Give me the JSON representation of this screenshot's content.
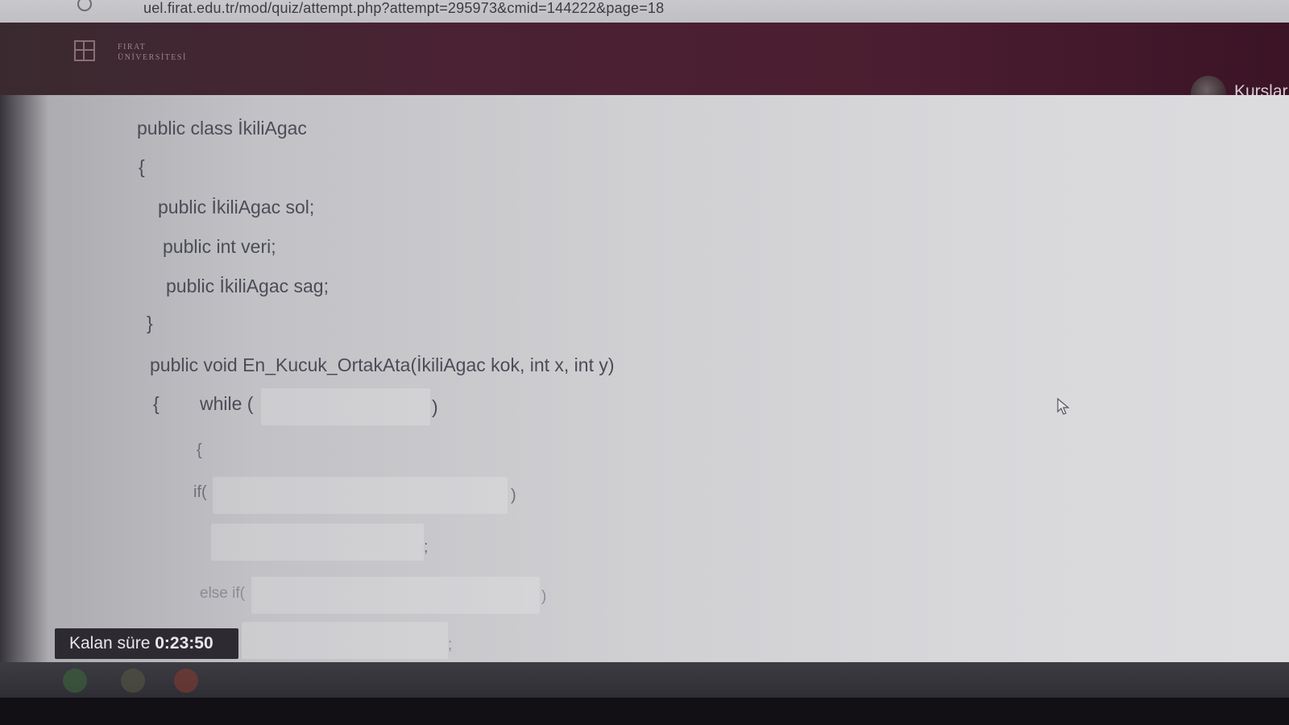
{
  "browser": {
    "url": "uel.firat.edu.tr/mod/quiz/attempt.php?attempt=295973&cmid=144222&page=18"
  },
  "header": {
    "logo_line1": "FIRAT",
    "logo_line2": "ÜNİVERSİTESİ",
    "nav_link": "Kurslar"
  },
  "question": {
    "code_lines": [
      "public class İkiliAgac",
      "{",
      "public İkiliAgac sol;",
      "public int veri;",
      "public İkiliAgac sag;",
      "}",
      "public void En_Kucuk_OrtakAta(İkiliAgac kok, int x, int y)",
      "{",
      "while (",
      ")",
      "{",
      "if(",
      ")",
      ";",
      "else if(",
      ")",
      ";"
    ]
  },
  "timer": {
    "label": "Kalan süre",
    "value": "0:23:50"
  },
  "colors": {
    "header": "#4b1d30",
    "content_bg": "#d0d0d3",
    "timer_bg": "#2d2b31"
  }
}
